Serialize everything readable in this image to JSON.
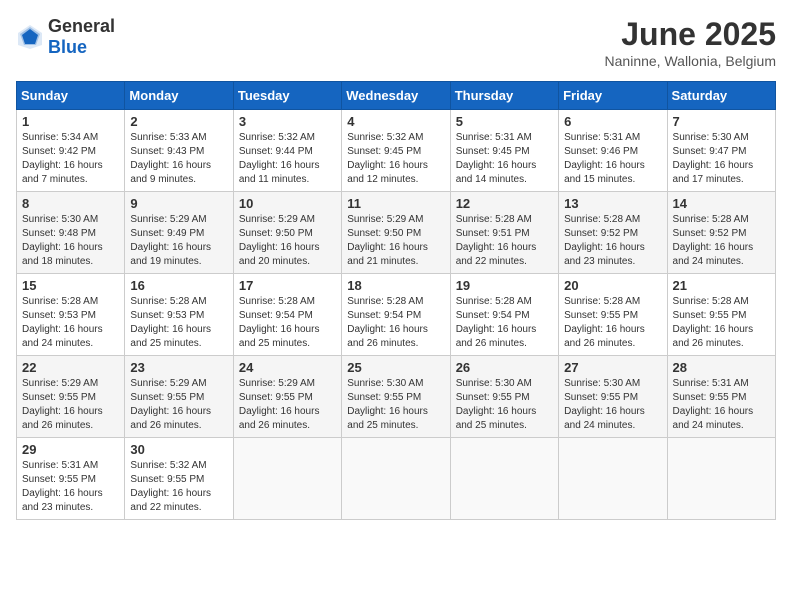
{
  "header": {
    "logo_general": "General",
    "logo_blue": "Blue",
    "month_title": "June 2025",
    "location": "Naninne, Wallonia, Belgium"
  },
  "weekdays": [
    "Sunday",
    "Monday",
    "Tuesday",
    "Wednesday",
    "Thursday",
    "Friday",
    "Saturday"
  ],
  "weeks": [
    [
      {
        "day": "1",
        "sunrise": "Sunrise: 5:34 AM",
        "sunset": "Sunset: 9:42 PM",
        "daylight": "Daylight: 16 hours and 7 minutes."
      },
      {
        "day": "2",
        "sunrise": "Sunrise: 5:33 AM",
        "sunset": "Sunset: 9:43 PM",
        "daylight": "Daylight: 16 hours and 9 minutes."
      },
      {
        "day": "3",
        "sunrise": "Sunrise: 5:32 AM",
        "sunset": "Sunset: 9:44 PM",
        "daylight": "Daylight: 16 hours and 11 minutes."
      },
      {
        "day": "4",
        "sunrise": "Sunrise: 5:32 AM",
        "sunset": "Sunset: 9:45 PM",
        "daylight": "Daylight: 16 hours and 12 minutes."
      },
      {
        "day": "5",
        "sunrise": "Sunrise: 5:31 AM",
        "sunset": "Sunset: 9:45 PM",
        "daylight": "Daylight: 16 hours and 14 minutes."
      },
      {
        "day": "6",
        "sunrise": "Sunrise: 5:31 AM",
        "sunset": "Sunset: 9:46 PM",
        "daylight": "Daylight: 16 hours and 15 minutes."
      },
      {
        "day": "7",
        "sunrise": "Sunrise: 5:30 AM",
        "sunset": "Sunset: 9:47 PM",
        "daylight": "Daylight: 16 hours and 17 minutes."
      }
    ],
    [
      {
        "day": "8",
        "sunrise": "Sunrise: 5:30 AM",
        "sunset": "Sunset: 9:48 PM",
        "daylight": "Daylight: 16 hours and 18 minutes."
      },
      {
        "day": "9",
        "sunrise": "Sunrise: 5:29 AM",
        "sunset": "Sunset: 9:49 PM",
        "daylight": "Daylight: 16 hours and 19 minutes."
      },
      {
        "day": "10",
        "sunrise": "Sunrise: 5:29 AM",
        "sunset": "Sunset: 9:50 PM",
        "daylight": "Daylight: 16 hours and 20 minutes."
      },
      {
        "day": "11",
        "sunrise": "Sunrise: 5:29 AM",
        "sunset": "Sunset: 9:50 PM",
        "daylight": "Daylight: 16 hours and 21 minutes."
      },
      {
        "day": "12",
        "sunrise": "Sunrise: 5:28 AM",
        "sunset": "Sunset: 9:51 PM",
        "daylight": "Daylight: 16 hours and 22 minutes."
      },
      {
        "day": "13",
        "sunrise": "Sunrise: 5:28 AM",
        "sunset": "Sunset: 9:52 PM",
        "daylight": "Daylight: 16 hours and 23 minutes."
      },
      {
        "day": "14",
        "sunrise": "Sunrise: 5:28 AM",
        "sunset": "Sunset: 9:52 PM",
        "daylight": "Daylight: 16 hours and 24 minutes."
      }
    ],
    [
      {
        "day": "15",
        "sunrise": "Sunrise: 5:28 AM",
        "sunset": "Sunset: 9:53 PM",
        "daylight": "Daylight: 16 hours and 24 minutes."
      },
      {
        "day": "16",
        "sunrise": "Sunrise: 5:28 AM",
        "sunset": "Sunset: 9:53 PM",
        "daylight": "Daylight: 16 hours and 25 minutes."
      },
      {
        "day": "17",
        "sunrise": "Sunrise: 5:28 AM",
        "sunset": "Sunset: 9:54 PM",
        "daylight": "Daylight: 16 hours and 25 minutes."
      },
      {
        "day": "18",
        "sunrise": "Sunrise: 5:28 AM",
        "sunset": "Sunset: 9:54 PM",
        "daylight": "Daylight: 16 hours and 26 minutes."
      },
      {
        "day": "19",
        "sunrise": "Sunrise: 5:28 AM",
        "sunset": "Sunset: 9:54 PM",
        "daylight": "Daylight: 16 hours and 26 minutes."
      },
      {
        "day": "20",
        "sunrise": "Sunrise: 5:28 AM",
        "sunset": "Sunset: 9:55 PM",
        "daylight": "Daylight: 16 hours and 26 minutes."
      },
      {
        "day": "21",
        "sunrise": "Sunrise: 5:28 AM",
        "sunset": "Sunset: 9:55 PM",
        "daylight": "Daylight: 16 hours and 26 minutes."
      }
    ],
    [
      {
        "day": "22",
        "sunrise": "Sunrise: 5:29 AM",
        "sunset": "Sunset: 9:55 PM",
        "daylight": "Daylight: 16 hours and 26 minutes."
      },
      {
        "day": "23",
        "sunrise": "Sunrise: 5:29 AM",
        "sunset": "Sunset: 9:55 PM",
        "daylight": "Daylight: 16 hours and 26 minutes."
      },
      {
        "day": "24",
        "sunrise": "Sunrise: 5:29 AM",
        "sunset": "Sunset: 9:55 PM",
        "daylight": "Daylight: 16 hours and 26 minutes."
      },
      {
        "day": "25",
        "sunrise": "Sunrise: 5:30 AM",
        "sunset": "Sunset: 9:55 PM",
        "daylight": "Daylight: 16 hours and 25 minutes."
      },
      {
        "day": "26",
        "sunrise": "Sunrise: 5:30 AM",
        "sunset": "Sunset: 9:55 PM",
        "daylight": "Daylight: 16 hours and 25 minutes."
      },
      {
        "day": "27",
        "sunrise": "Sunrise: 5:30 AM",
        "sunset": "Sunset: 9:55 PM",
        "daylight": "Daylight: 16 hours and 24 minutes."
      },
      {
        "day": "28",
        "sunrise": "Sunrise: 5:31 AM",
        "sunset": "Sunset: 9:55 PM",
        "daylight": "Daylight: 16 hours and 24 minutes."
      }
    ],
    [
      {
        "day": "29",
        "sunrise": "Sunrise: 5:31 AM",
        "sunset": "Sunset: 9:55 PM",
        "daylight": "Daylight: 16 hours and 23 minutes."
      },
      {
        "day": "30",
        "sunrise": "Sunrise: 5:32 AM",
        "sunset": "Sunset: 9:55 PM",
        "daylight": "Daylight: 16 hours and 22 minutes."
      },
      null,
      null,
      null,
      null,
      null
    ]
  ]
}
